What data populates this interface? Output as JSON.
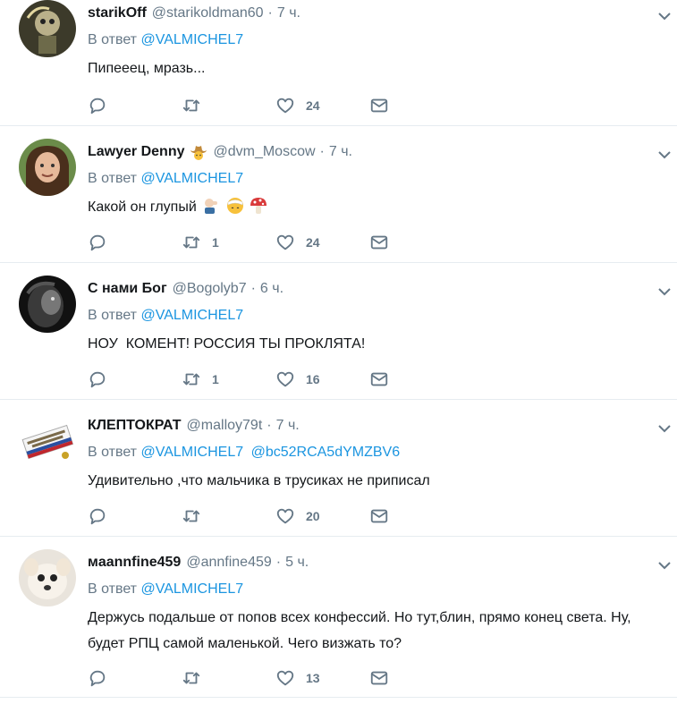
{
  "labels": {
    "reply_prefix": "В ответ"
  },
  "tweets": [
    {
      "name": "starikOff",
      "handle": "@starikoldman60",
      "time": "7 ч.",
      "reply_to": [
        "@VALMICHEL7"
      ],
      "text": "Пипееец, мразь...",
      "retweets": "",
      "likes": "24"
    },
    {
      "name": "Lawyer Denny",
      "handle": "@dvm_Moscow",
      "time": "7 ч.",
      "reply_to": [
        "@VALMICHEL7"
      ],
      "text": "Какой он глупый",
      "retweets": "1",
      "likes": "24"
    },
    {
      "name": "С нами Бог",
      "handle": "@Bogolyb7",
      "time": "6 ч.",
      "reply_to": [
        "@VALMICHEL7"
      ],
      "text": "НОУ  КОМЕНТ! РОССИЯ ТЫ ПРОКЛЯТА!",
      "retweets": "1",
      "likes": "16"
    },
    {
      "name": "КЛЕПТОКРАТ",
      "handle": "@malloy79t",
      "time": "7 ч.",
      "reply_to": [
        "@VALMICHEL7",
        "@bc52RCA5dYMZBV6"
      ],
      "text": "Удивительно ,что мальчика в трусиках не приписал",
      "retweets": "",
      "likes": "20"
    },
    {
      "name": "мaannfine459",
      "handle": "@annfine459",
      "time": "5 ч.",
      "reply_to": [
        "@VALMICHEL7"
      ],
      "text": "Держусь подальше от попов всех конфессий. Но тут,блин, прямо конец света. Ну, будет РПЦ самой маленькой. Чего визжать то?",
      "retweets": "",
      "likes": "13"
    }
  ],
  "colors": {
    "link": "#1b95e0",
    "muted": "#657786",
    "text": "#14171a",
    "divider": "#e6ecf0"
  },
  "icons": [
    "reply-icon",
    "retweet-icon",
    "like-icon",
    "dm-icon",
    "chevron-down-icon"
  ]
}
